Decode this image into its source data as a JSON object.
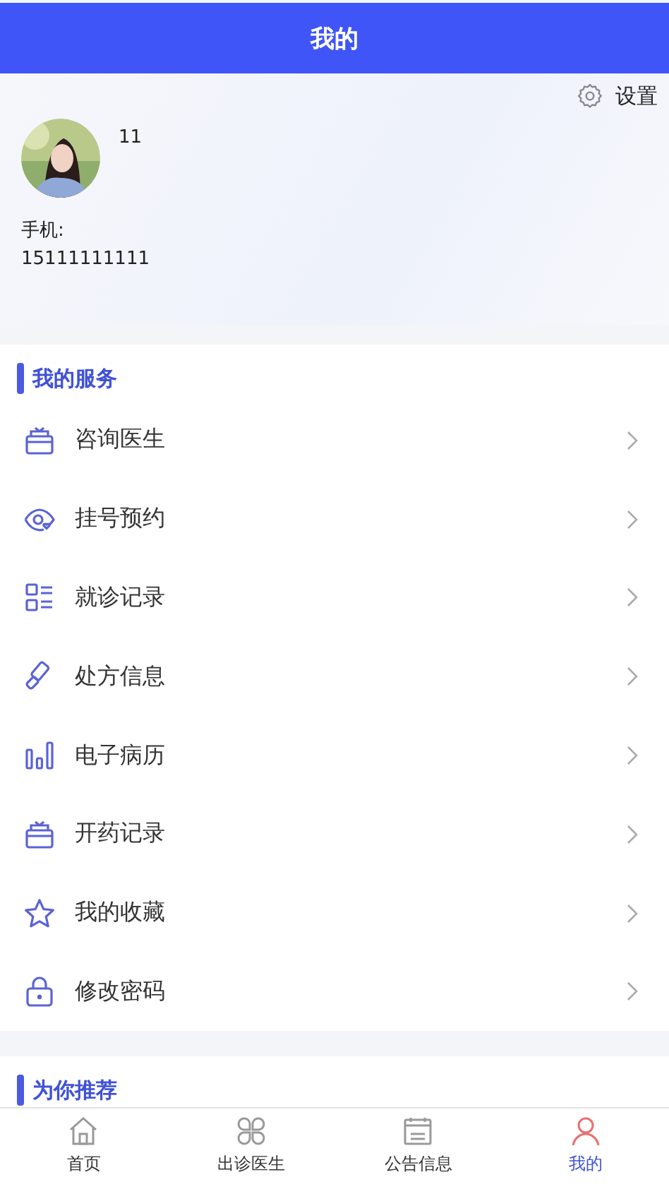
{
  "header": {
    "title": "我的"
  },
  "profile": {
    "settings_label": "设置",
    "username": "11",
    "phone_label": "手机:",
    "phone": "15111111111"
  },
  "services": {
    "title": "我的服务",
    "items": [
      {
        "kind": "gift",
        "label": "咨询医生"
      },
      {
        "kind": "eye",
        "label": "挂号预约"
      },
      {
        "kind": "list",
        "label": "就诊记录"
      },
      {
        "kind": "brush",
        "label": "处方信息"
      },
      {
        "kind": "bars",
        "label": "电子病历"
      },
      {
        "kind": "gift",
        "label": "开药记录"
      },
      {
        "kind": "star",
        "label": "我的收藏"
      },
      {
        "kind": "lock",
        "label": "修改密码"
      }
    ]
  },
  "recommend": {
    "title": "为你推荐"
  },
  "tab_bar": [
    {
      "kind": "home",
      "label": "首页",
      "selected": false
    },
    {
      "kind": "grid",
      "label": "出诊医生",
      "selected": false
    },
    {
      "kind": "notice",
      "label": "公告信息",
      "selected": false
    },
    {
      "kind": "user",
      "label": "我的",
      "selected": true
    }
  ]
}
